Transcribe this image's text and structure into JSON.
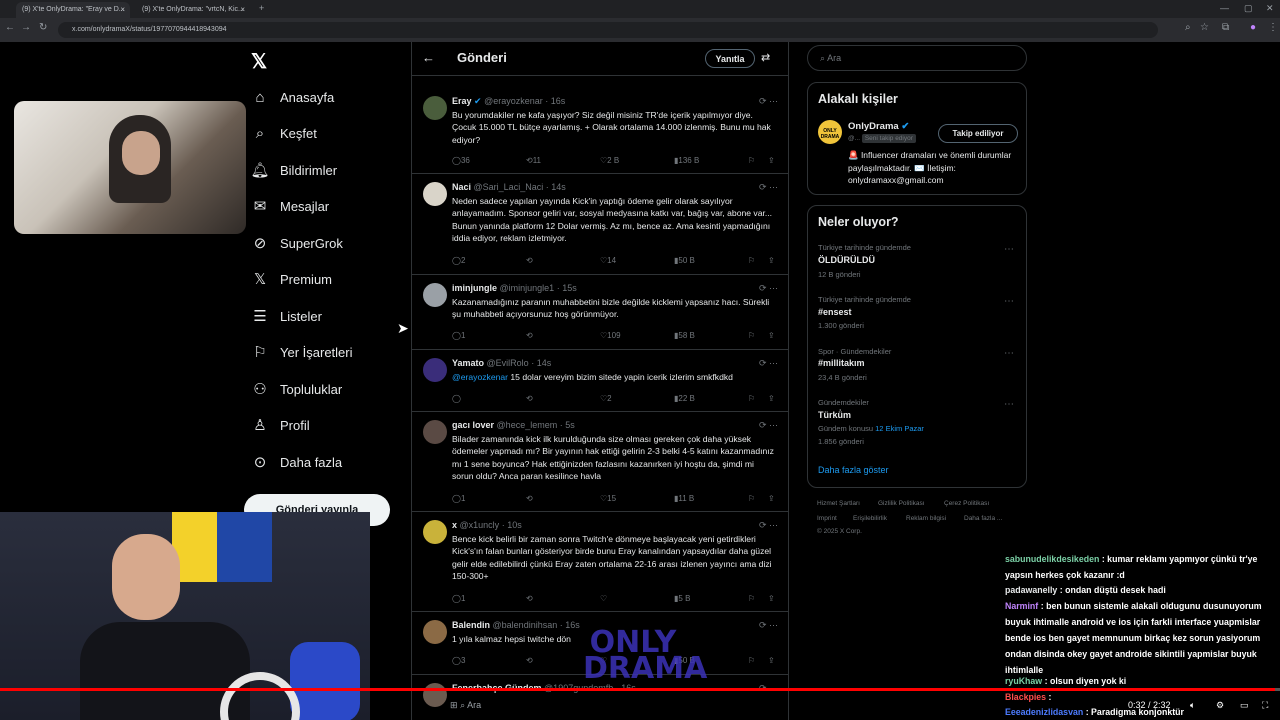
{
  "browser": {
    "tabs": [
      {
        "label": "(9) X'te OnlyDrama: \"Eray ve D..."
      },
      {
        "label": "(9) X'te OnlyDrama: \"vrtcN, Kic..."
      }
    ],
    "url": "x.com/onlydramaX/status/1977070944418943094"
  },
  "nav": {
    "items": [
      {
        "label": "Anasayfa",
        "icon": "home-icon"
      },
      {
        "label": "Keşfet",
        "icon": "search-icon"
      },
      {
        "label": "Bildirimler",
        "icon": "bell-icon"
      },
      {
        "label": "Mesajlar",
        "icon": "mail-icon"
      },
      {
        "label": "SuperGrok",
        "icon": "grok-icon"
      },
      {
        "label": "Premium",
        "icon": "x-icon"
      },
      {
        "label": "Listeler",
        "icon": "list-icon"
      },
      {
        "label": "Yer İşaretleri",
        "icon": "bookmark-icon"
      },
      {
        "label": "Topluluklar",
        "icon": "people-icon"
      },
      {
        "label": "Profil",
        "icon": "person-icon"
      },
      {
        "label": "Daha fazla",
        "icon": "more-icon"
      }
    ],
    "post_button": "Gönderi yayınla"
  },
  "header": {
    "title": "Gönderi",
    "reply_button": "Yanıtla"
  },
  "tweets": [
    {
      "name": "Eray",
      "handle": "@erayozkenar",
      "time": "16s",
      "verified": true,
      "text": "Bu yorumdakiler ne kafa yaşıyor? Siz değil misiniz TR'de içerik yapılmıyor diye. Çocuk 15.000 TL bütçe ayarlamış. + Olarak ortalama 14.000 izlenmiş. Bunu mu hak ediyor?",
      "replies": "36",
      "reposts": "11",
      "likes": "2 B",
      "views": "136 B"
    },
    {
      "name": "Naci",
      "handle": "@Sari_Laci_Naci",
      "time": "14s",
      "verified": false,
      "text": "Neden sadece yapılan yayında Kick'in yaptığı ödeme gelir olarak sayılıyor anlayamadım. Sponsor geliri var, sosyal medyasına katkı var, bağış var, abone var... Bunun yanında platform 12 Dolar vermiş. Az mı, bence az. Ama kesinti yapmadığını iddia ediyor, reklam izletmiyor.",
      "replies": "2",
      "reposts": "",
      "likes": "14",
      "views": "50 B"
    },
    {
      "name": "iminjungle",
      "handle": "@iminjungle1",
      "time": "15s",
      "verified": false,
      "text": "Kazanamadığınız paranın muhabbetini bizle değilde kicklemi yapsanız hacı. Sürekli şu muhabbeti açıyorsunuz hoş görünmüyor.",
      "replies": "1",
      "reposts": "",
      "likes": "109",
      "views": "58 B"
    },
    {
      "name": "Yamato",
      "handle": "@EvilRolo",
      "time": "14s",
      "verified": false,
      "mention": "@erayozkenar",
      "text": " 15 dolar vereyim bizim sitede yapin icerik izlerim smkfkdkd",
      "replies": "",
      "reposts": "",
      "likes": "2",
      "views": "22 B"
    },
    {
      "name": "gacı lover",
      "handle": "@hece_lemem",
      "time": "5s",
      "verified": false,
      "text": "Bilader zamanında kick ilk kurulduğunda size olması gereken çok daha yüksek ödemeler yapmadı mı? Bir yayının hak ettiği gelirin 2-3 belki 4-5 katını kazanmadınız mı 1 sene boyunca? Hak ettiğinizden fazlasını kazanırken iyi hoştu da, şimdi mi sorun oldu? Anca paran kesilince havla",
      "replies": "1",
      "reposts": "",
      "likes": "15",
      "views": "11 B"
    },
    {
      "name": "x",
      "handle": "@x1uncly",
      "time": "10s",
      "verified": false,
      "text": "Bence kick belirli bir zaman sonra Twitch'e dönmeye başlayacak yeni getirdikleri Kick's'ın falan bunları gösteriyor birde bunu Eray kanalından yapsaydılar daha güzel gelir elde edilebilirdi çünkü Eray zaten ortalama 22-16 arası izlenen yayıncı ama dizi 150-300+",
      "replies": "1",
      "reposts": "",
      "likes": "",
      "views": "5 B"
    },
    {
      "name": "Balendin",
      "handle": "@balendinihsan",
      "time": "16s",
      "verified": false,
      "text": "1 yıla kalmaz hepsi twitche dön",
      "replies": "3",
      "reposts": "",
      "likes": "",
      "views": "50 B"
    },
    {
      "name": "Fenerbahçe Gündem",
      "handle": "@1907gundemfb",
      "time": "16s",
      "verified": false,
      "text": "",
      "replies": "",
      "reposts": "",
      "likes": "",
      "views": ""
    }
  ],
  "watermark": "ONLY DRAMA",
  "search": {
    "placeholder": "Ara"
  },
  "related": {
    "title": "Alakalı kişiler",
    "name": "OnlyDrama",
    "handle": "@...",
    "follows_you": "Seni takip ediyor",
    "follow_button": "Takip ediliyor",
    "bio": "🚨 Influencer dramaları ve önemli durumlar paylaşılmaktadır. ✉️ İletişim: onlydramaxx@gmail.com",
    "logo_text": "ONLY DRAMA"
  },
  "trends": {
    "title": "Neler oluyor?",
    "items": [
      {
        "meta": "Türkiye tarihinde gündemde",
        "name": "ÖLDÜRÜLDÜ",
        "posts": "12 B gönderi"
      },
      {
        "meta": "Türkiye tarihinde gündemde",
        "name": "#ensest",
        "posts": "1.300 gönderi"
      },
      {
        "meta": "Spor · Gündemdekiler",
        "name": "#millitakım",
        "posts": "23,4 B gönderi"
      },
      {
        "meta": "Gündemdekiler",
        "name": "Türkü̇m",
        "posts": "1.856 gönderi",
        "topic": "Gündem konusu",
        "topic_link": "12 Ekim Pazar"
      }
    ],
    "show_more": "Daha fazla göster"
  },
  "footer": {
    "links": [
      "Hizmet Şartları",
      "Gizlilik Politikası",
      "Çerez Politikası",
      "Imprint",
      "Erişilebilirlik",
      "Reklam bilgisi",
      "Daha fazla ..."
    ],
    "copyright": "© 2025 X Corp."
  },
  "chat": [
    {
      "user": "sabunudelikdesikeden",
      "color": "#7bd0a6",
      "text": ": kumar reklamı yapmıyor çünkü tr'ye yapsın herkes çok kazanır :d"
    },
    {
      "user": "padawanelly",
      "color": "#ffffff",
      "text": ": ondan düştü desek hadi"
    },
    {
      "user": "Narminf",
      "color": "#c084fc",
      "text": ": ben bunun sistemle alakali oldugunu dusunuyorum buyuk ihtimalle android ve ios için farkli interface yuapmislar bende ios ben gayet memnunum birkaç kez sorun yasiyorum ondan disinda okey gayet androide sikintili yapmislar buyuk ihtimlalle"
    },
    {
      "user": "ryuKhaw",
      "color": "#7bd0a6",
      "text": ": olsun diyen yok ki"
    },
    {
      "user": "Blackpies",
      "color": "#ff4d4d",
      "text": ":"
    },
    {
      "user": "Eeeadenizlidasvan",
      "color": "#4d7cff",
      "text": ": Paradigma konjonktür"
    }
  ],
  "player": {
    "time": "0:32 / 2:32"
  },
  "taskbar": {
    "search": "Ara"
  }
}
